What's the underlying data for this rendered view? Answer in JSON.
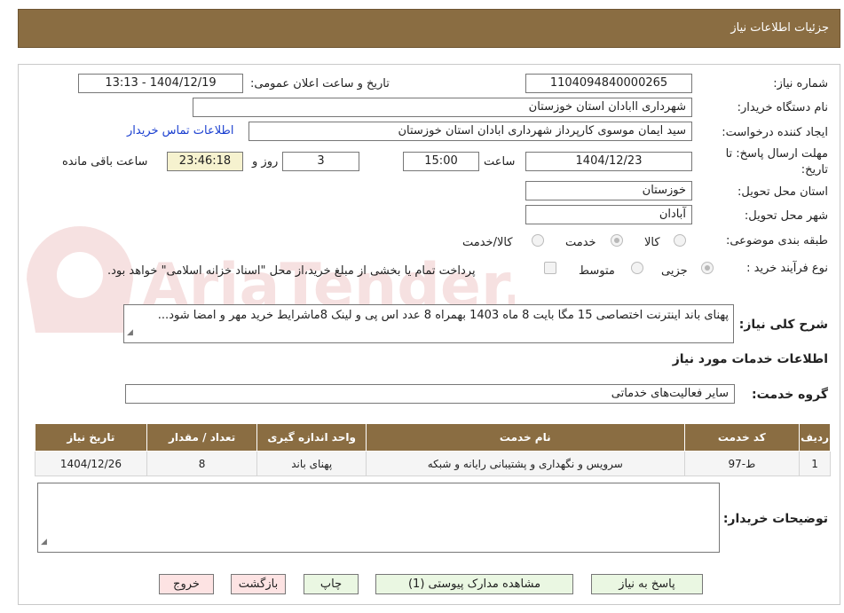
{
  "header": {
    "title": "جزئیات اطلاعات نیاز"
  },
  "watermark": {
    "text": "AriaTender.neT"
  },
  "fields": {
    "need_number_label": "شماره نیاز:",
    "need_number": "1104094840000265",
    "announce_label": "تاریخ و ساعت اعلان عمومی:",
    "announce_value": "1404/12/19 - 13:13",
    "buyer_org_label": "نام دستگاه خریدار:",
    "buyer_org": "شهرداری اابادان استان خوزستان",
    "creator_label": "ایجاد کننده درخواست:",
    "creator": "سید ایمان موسوی کارپرداز شهرداری ابادان استان خوزستان",
    "contact_link": "اطلاعات تماس خریدار",
    "deadline_label_1": "مهلت ارسال پاسخ: تا",
    "deadline_label_2": "تاریخ:",
    "deadline_date": "1404/12/23",
    "time_label": "ساعت",
    "deadline_time": "15:00",
    "days_value": "3",
    "days_label": "روز و",
    "remaining_time": "23:46:18",
    "remaining_label": "ساعت باقی مانده",
    "province_label": "استان محل تحویل:",
    "province": "خوزستان",
    "city_label": "شهر محل تحویل:",
    "city": "آبادان",
    "category_label": "طبقه بندی موضوعی:",
    "category_options": [
      "کالا",
      "خدمت",
      "کالا/خدمت"
    ],
    "purchase_type_label": "نوع فرآیند خرید :",
    "purchase_type_options": [
      "جزیی",
      "متوسط"
    ],
    "payment_note": "پرداخت تمام یا بخشی از مبلغ خرید،از محل \"اسناد خزانه اسلامی\" خواهد بود."
  },
  "description": {
    "label": "شرح کلی نیاز:",
    "text": "پهنای باند اینترنت اختصاصی 15 مگا بایت 8 ماه 1403 بهمراه 8 عدد اس پی و لینک 8ماشرایط خرید مهر و امضا شود..."
  },
  "services": {
    "section_title": "اطلاعات خدمات مورد نیاز",
    "group_label": "گروه خدمت:",
    "group_value": "سایر فعالیت‌های خدماتی",
    "columns": [
      "ردیف",
      "کد خدمت",
      "نام خدمت",
      "واحد اندازه گیری",
      "تعداد / مقدار",
      "تاریخ نیاز"
    ],
    "rows": [
      [
        "1",
        "ط-97",
        "سرویس و نگهداری و پشتیبانی رایانه و شبکه",
        "پهنای باند",
        "8",
        "1404/12/26"
      ]
    ]
  },
  "buyer_notes": {
    "label": "توضیحات خریدار:",
    "value": ""
  },
  "buttons": {
    "reply": "پاسخ به نیاز",
    "attachments": "مشاهده مدارک پیوستی (1)",
    "print": "چاپ",
    "back": "بازگشت",
    "exit": "خروج"
  },
  "colors": {
    "header_bg": "#8a6d42",
    "link": "#1a3fd0",
    "button_green": "#eaf7e2",
    "button_pink": "#fde3e3"
  }
}
